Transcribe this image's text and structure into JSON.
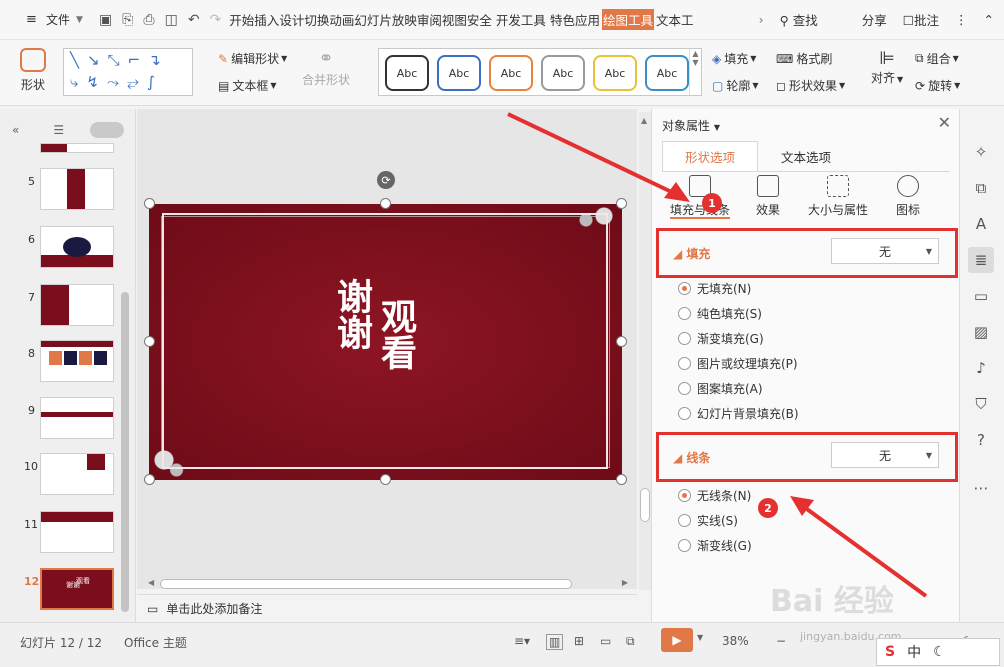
{
  "menubar": {
    "file_label": "文件",
    "tabs": [
      "开始",
      "插入",
      "设计",
      "切换",
      "动画",
      "幻灯片放映",
      "审阅",
      "视图",
      "安全",
      "开发工具",
      "特色应用",
      "绘图工具",
      "文本工"
    ],
    "active_tab": "绘图工具",
    "search_label": "查找",
    "share_label": "分享",
    "comment_label": "批注"
  },
  "ribbon": {
    "shape_label": "形状",
    "edit_shape_label": "编辑形状",
    "textbox_label": "文本框",
    "merge_shape_label": "合并形状",
    "style_abc": [
      "Abc",
      "Abc",
      "Abc",
      "Abc",
      "Abc",
      "Abc"
    ],
    "style_colors": [
      "#333333",
      "#3a6fc4",
      "#e8843a",
      "#999999",
      "#e8c23a",
      "#3a8fc4"
    ],
    "fill_label": "填充",
    "format_brush_label": "格式刷",
    "outline_label": "轮廓",
    "shape_effect_label": "形状效果",
    "align_label": "对齐",
    "group_label": "组合",
    "rotate_label": "旋转"
  },
  "slides": {
    "numbers": [
      "5",
      "6",
      "7",
      "8",
      "9",
      "10",
      "11",
      "12"
    ],
    "active": "12",
    "current_text": [
      "谢谢",
      "观看"
    ]
  },
  "notes_placeholder": "单击此处添加备注",
  "props": {
    "title": "对象属性",
    "tab_shape": "形状选项",
    "tab_text": "文本选项",
    "subtabs": [
      "填充与线条",
      "效果",
      "大小与属性",
      "图标"
    ],
    "fill_section": "填充",
    "fill_value": "无",
    "fill_options": [
      "无填充(N)",
      "纯色填充(S)",
      "渐变填充(G)",
      "图片或纹理填充(P)",
      "图案填充(A)",
      "幻灯片背景填充(B)"
    ],
    "line_section": "线条",
    "line_value": "无",
    "line_options": [
      "无线条(N)",
      "实线(S)",
      "渐变线(G)"
    ],
    "annotation_1": "1",
    "annotation_2": "2"
  },
  "status": {
    "slide_count": "幻灯片 12 / 12",
    "theme": "Office 主题",
    "zoom": "38%"
  },
  "ime": {
    "s_logo": "S",
    "lang": "中"
  },
  "watermark": {
    "logo": "Bai 经验",
    "url": "jingyan.baidu.com"
  }
}
